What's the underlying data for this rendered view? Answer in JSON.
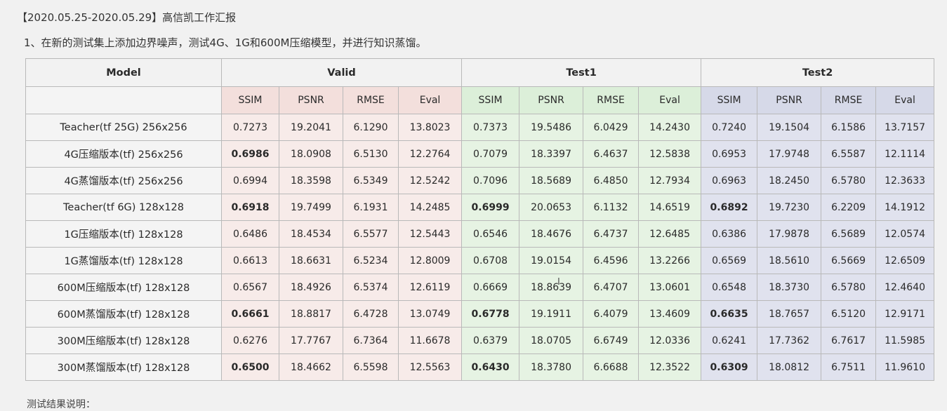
{
  "report": {
    "title": "【2020.05.25-2020.05.29】高信凯工作汇报",
    "task": "1、在新的测试集上添加边界噪声，测试4G、1G和600M压缩模型，并进行知识蒸馏。",
    "footer": "测试结果说明："
  },
  "table": {
    "model_header": "Model",
    "groups": [
      "Valid",
      "Test1",
      "Test2"
    ],
    "metrics": [
      "SSIM",
      "PSNR",
      "RMSE",
      "Eval"
    ],
    "rows": [
      {
        "model": "Teacher(tf 25G) 256x256",
        "valid": [
          "0.7273",
          "19.2041",
          "6.1290",
          "13.8023"
        ],
        "test1": [
          "0.7373",
          "19.5486",
          "6.0429",
          "14.2430"
        ],
        "test2": [
          "0.7240",
          "19.1504",
          "6.1586",
          "13.7157"
        ],
        "bold": []
      },
      {
        "model": "4G压缩版本(tf)  256x256",
        "valid": [
          "0.6986",
          "18.0908",
          "6.5130",
          "12.2764"
        ],
        "test1": [
          "0.7079",
          "18.3397",
          "6.4637",
          "12.5838"
        ],
        "test2": [
          "0.6953",
          "17.9748",
          "6.5587",
          "12.1114"
        ],
        "bold": [
          "valid"
        ]
      },
      {
        "model": "4G蒸馏版本(tf)  256x256",
        "valid": [
          "0.6994",
          "18.3598",
          "6.5349",
          "12.5242"
        ],
        "test1": [
          "0.7096",
          "18.5689",
          "6.4850",
          "12.7934"
        ],
        "test2": [
          "0.6963",
          "18.2450",
          "6.5780",
          "12.3633"
        ],
        "bold": []
      },
      {
        "model": "Teacher(tf 6G) 128x128",
        "valid": [
          "0.6918",
          "19.7499",
          "6.1931",
          "14.2485"
        ],
        "test1": [
          "0.6999",
          "20.0653",
          "6.1132",
          "14.6519"
        ],
        "test2": [
          "0.6892",
          "19.7230",
          "6.2209",
          "14.1912"
        ],
        "bold": [
          "valid",
          "test1",
          "test2"
        ]
      },
      {
        "model": "1G压缩版本(tf)  128x128",
        "valid": [
          "0.6486",
          "18.4534",
          "6.5577",
          "12.5443"
        ],
        "test1": [
          "0.6546",
          "18.4676",
          "6.4737",
          "12.6485"
        ],
        "test2": [
          "0.6386",
          "17.9878",
          "6.5689",
          "12.0574"
        ],
        "bold": []
      },
      {
        "model": "1G蒸馏版本(tf)  128x128",
        "valid": [
          "0.6613",
          "18.6631",
          "6.5234",
          "12.8009"
        ],
        "test1": [
          "0.6708",
          "19.0154",
          "6.4596",
          "13.2266"
        ],
        "test2": [
          "0.6569",
          "18.5610",
          "6.5669",
          "12.6509"
        ],
        "bold": []
      },
      {
        "model": "600M压缩版本(tf) 128x128",
        "valid": [
          "0.6567",
          "18.4926",
          "6.5374",
          "12.6119"
        ],
        "test1": [
          "0.6669",
          "18.8639",
          "6.4707",
          "13.0601"
        ],
        "test2": [
          "0.6548",
          "18.3730",
          "6.5780",
          "12.4640"
        ],
        "bold": []
      },
      {
        "model": "600M蒸馏版本(tf) 128x128",
        "valid": [
          "0.6661",
          "18.8817",
          "6.4728",
          "13.0749"
        ],
        "test1": [
          "0.6778",
          "19.1911",
          "6.4079",
          "13.4609"
        ],
        "test2": [
          "0.6635",
          "18.7657",
          "6.5120",
          "12.9171"
        ],
        "bold": [
          "valid",
          "test1",
          "test2"
        ]
      },
      {
        "model": "300M压缩版本(tf) 128x128",
        "valid": [
          "0.6276",
          "17.7767",
          "6.7364",
          "11.6678"
        ],
        "test1": [
          "0.6379",
          "18.0705",
          "6.6749",
          "12.0336"
        ],
        "test2": [
          "0.6241",
          "17.7362",
          "6.7617",
          "11.5985"
        ],
        "bold": []
      },
      {
        "model": "300M蒸馏版本(tf) 128x128",
        "valid": [
          "0.6500",
          "18.4662",
          "6.5598",
          "12.5563"
        ],
        "test1": [
          "0.6430",
          "18.3780",
          "6.6688",
          "12.3522"
        ],
        "test2": [
          "0.6309",
          "18.0812",
          "6.7511",
          "11.9610"
        ],
        "bold": [
          "valid",
          "test1",
          "test2"
        ]
      }
    ]
  },
  "colors": {
    "valid_header": "#f3dfdc",
    "test1_header": "#dcefd9",
    "test2_header": "#d6d9e8"
  }
}
